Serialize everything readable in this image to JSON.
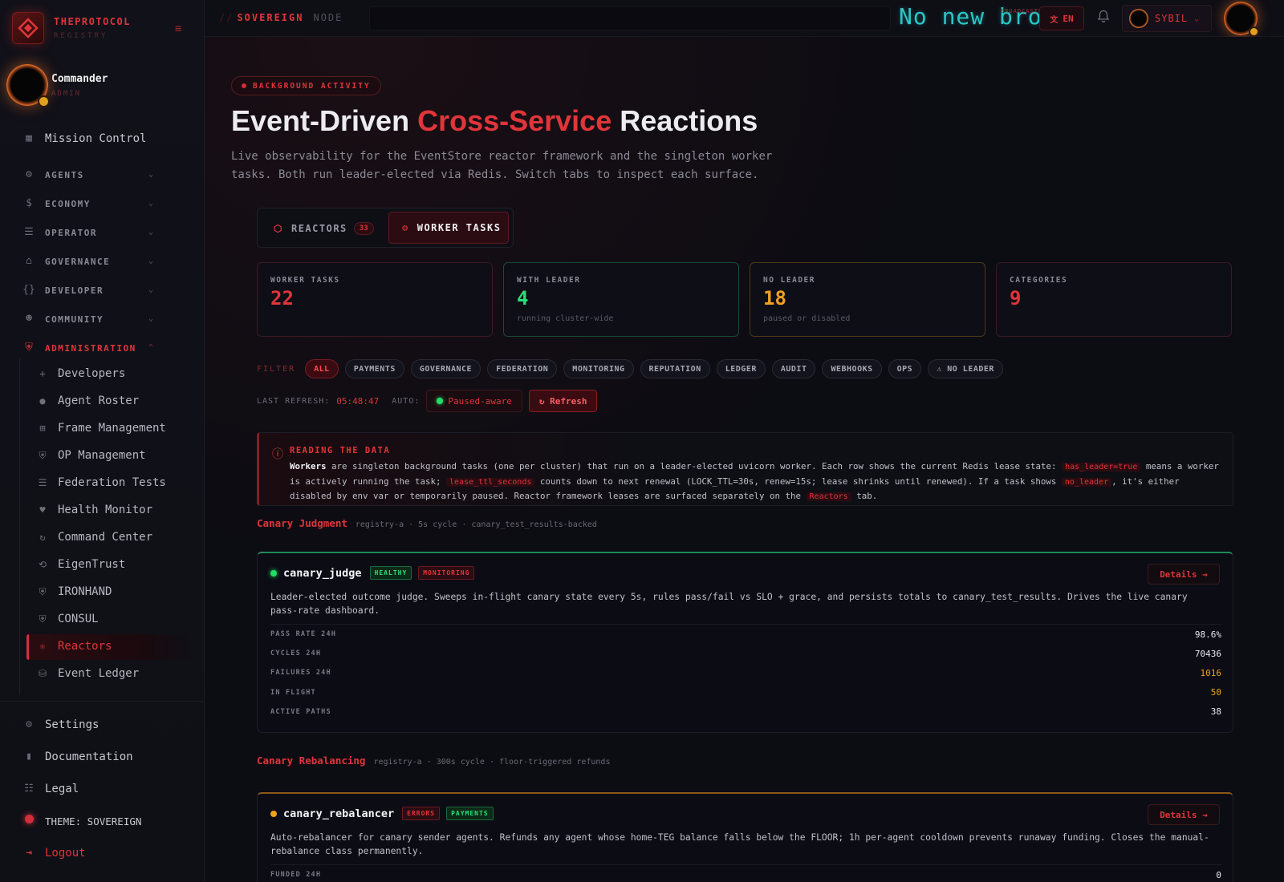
{
  "brand": {
    "name": "THEPROTOCOL",
    "sub": "REGISTRY"
  },
  "user": {
    "name": "Commander",
    "role": "ADMIN"
  },
  "nav": {
    "mission_control": "Mission Control",
    "sections": [
      {
        "label": "AGENTS",
        "icon": "robot-icon"
      },
      {
        "label": "ECONOMY",
        "icon": "dollar-icon"
      },
      {
        "label": "OPERATOR",
        "icon": "server-icon"
      },
      {
        "label": "GOVERNANCE",
        "icon": "bank-icon"
      },
      {
        "label": "DEVELOPER",
        "icon": "braces-icon"
      },
      {
        "label": "COMMUNITY",
        "icon": "people-icon"
      }
    ],
    "administration": "ADMINISTRATION",
    "admin_items": [
      {
        "label": "Developers",
        "icon": "user-plus-icon"
      },
      {
        "label": "Agent Roster",
        "icon": "user-icon"
      },
      {
        "label": "Frame Management",
        "icon": "frame-icon"
      },
      {
        "label": "OP Management",
        "icon": "shield-icon"
      },
      {
        "label": "Federation Tests",
        "icon": "server-stack-icon"
      },
      {
        "label": "Health Monitor",
        "icon": "heart-pulse-icon"
      },
      {
        "label": "Command Center",
        "icon": "refresh-cw-icon"
      },
      {
        "label": "EigenTrust",
        "icon": "search-refresh-icon"
      },
      {
        "label": "IRONHAND",
        "icon": "shield-icon"
      },
      {
        "label": "CONSUL",
        "icon": "shield-check-icon"
      },
      {
        "label": "Reactors",
        "icon": "atom-icon"
      },
      {
        "label": "Event Ledger",
        "icon": "ledger-icon"
      }
    ],
    "bottom": {
      "settings": "Settings",
      "documentation": "Documentation",
      "legal": "Legal",
      "theme": "THEME: SOVEREIGN",
      "logout": "Logout"
    }
  },
  "topbar": {
    "crumb_slashes": "//",
    "crumb_primary": "SOVEREIGN",
    "crumb_secondary": "NODE",
    "ticker": "No new bro",
    "ticker_tag": "BROADCASTS",
    "lang": "EN",
    "account": "SYBIL"
  },
  "page": {
    "tag": "BACKGROUND ACTIVITY",
    "title_pre": "Event-Driven ",
    "title_accent": "Cross-Service",
    "title_post": " Reactions",
    "subtitle": "Live observability for the EventStore reactor framework and the singleton worker tasks. Both run leader-elected via Redis. Switch tabs to inspect each surface."
  },
  "tabs": {
    "reactors_label": "REACTORS",
    "reactors_count": "33",
    "workers_label": "WORKER TASKS"
  },
  "stats": [
    {
      "label": "WORKER TASKS",
      "value": "22",
      "sub": "",
      "color": "#e0353a",
      "border": "#3a1a22"
    },
    {
      "label": "WITH LEADER",
      "value": "4",
      "sub": "running cluster-wide",
      "color": "#2ade78",
      "border": "#1a4a36"
    },
    {
      "label": "NO LEADER",
      "value": "18",
      "sub": "paused or disabled",
      "color": "#f0a020",
      "border": "#4a3a1a"
    },
    {
      "label": "CATEGORIES",
      "value": "9",
      "sub": "",
      "color": "#e0353a",
      "border": "#3a1a22"
    }
  ],
  "filter": {
    "label": "FILTER",
    "chips": [
      "ALL",
      "PAYMENTS",
      "GOVERNANCE",
      "FEDERATION",
      "MONITORING",
      "REPUTATION",
      "LEDGER",
      "AUDIT",
      "WEBHOOKS",
      "OPS",
      "⚠ NO LEADER"
    ]
  },
  "refresh": {
    "last_label": "LAST REFRESH:",
    "time": "05:48:47",
    "auto_label": "AUTO:",
    "paused": "Paused-aware",
    "refresh": "↻ Refresh"
  },
  "info": {
    "title": "READING THE DATA",
    "b_workers": "Workers",
    "t1": " are singleton background tasks (one per cluster) that run on a leader-elected uvicorn worker. Each row shows the current Redis lease state: ",
    "c1": "has_leader=true",
    "t2": " means a worker is actively running the task; ",
    "c2": "lease_ttl_seconds",
    "t3": " counts down to next renewal (LOCK_TTL=30s, renew=15s; lease shrinks until renewed). If a task shows ",
    "c3": "no_leader",
    "t4": ", it's either disabled by env var or temporarily paused. Reactor framework leases are surfaced separately on the ",
    "c4": "Reactors",
    "t5": " tab."
  },
  "groups": [
    {
      "title": "Canary Judgment",
      "meta": "registry-a · 5s cycle · canary_test_results-backed",
      "worker": {
        "name": "canary_judge",
        "badges": [
          "HEALTHY",
          "MONITORING"
        ],
        "status_color": "#22dd66",
        "details": "Details →",
        "desc": "Leader-elected outcome judge. Sweeps in-flight canary state every 5s, rules pass/fail vs SLO + grace, and persists totals to canary_test_results. Drives the live canary pass-rate dashboard.",
        "stats": [
          {
            "label": "PASS RATE 24H",
            "value": "98.6%",
            "color": "#e8e8ee"
          },
          {
            "label": "CYCLES 24H",
            "value": "70436",
            "color": "#e8e8ee"
          },
          {
            "label": "FAILURES 24H",
            "value": "1016",
            "color": "#f0a020"
          },
          {
            "label": "IN FLIGHT",
            "value": "50",
            "color": "#f0a020"
          },
          {
            "label": "ACTIVE PATHS",
            "value": "38",
            "color": "#e8e8ee"
          }
        ]
      }
    },
    {
      "title": "Canary Rebalancing",
      "meta": "registry-a · 300s cycle · floor-triggered refunds",
      "worker": {
        "name": "canary_rebalancer",
        "badges": [
          "ERRORS",
          "PAYMENTS"
        ],
        "status_color": "#f0a020",
        "details": "Details →",
        "desc": "Auto-rebalancer for canary sender agents. Refunds any agent whose home-TEG balance falls below the FLOOR; 1h per-agent cooldown prevents runaway funding. Closes the manual-rebalance class permanently.",
        "stats": [
          {
            "label": "FUNDED 24H",
            "value": "0",
            "color": "#e8e8ee"
          }
        ]
      }
    }
  ]
}
